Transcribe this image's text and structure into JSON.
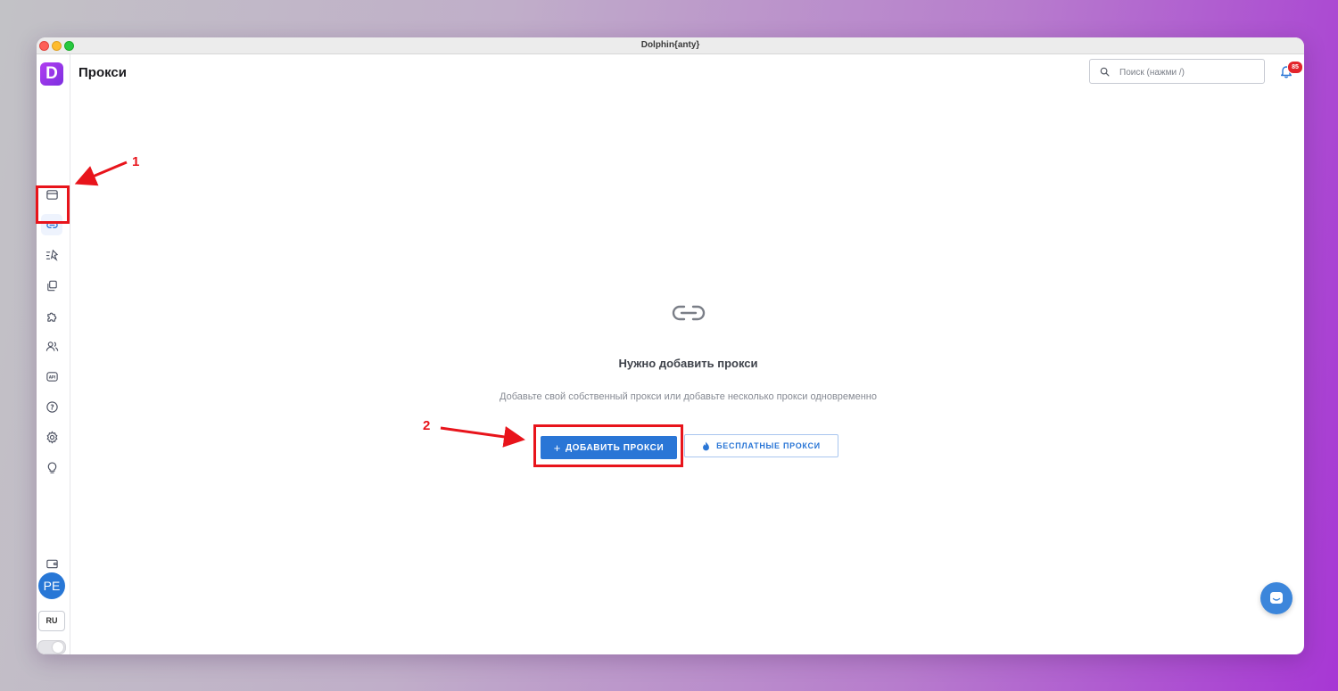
{
  "window": {
    "title": "Dolphin{anty}"
  },
  "logo": {
    "letter": "D"
  },
  "page": {
    "title": "Прокси"
  },
  "search": {
    "placeholder": "Поиск (нажми /)"
  },
  "notifications": {
    "count": "85"
  },
  "empty_state": {
    "title": "Нужно добавить прокси",
    "subtitle": "Добавьте свой собственный прокси или добавьте несколько прокси одновременно",
    "icon": "link-icon"
  },
  "buttons": {
    "add_proxy": "ДОБАВИТЬ ПРОКСИ",
    "add_proxy_icon": "+",
    "free_proxy": "БЕСПЛАТНЫЕ ПРОКСИ"
  },
  "sidebar": {
    "items": [
      {
        "icon": "browser-window-icon",
        "active": false
      },
      {
        "icon": "link-icon",
        "active": true
      },
      {
        "icon": "automation-icon",
        "active": false
      },
      {
        "icon": "copy-icon",
        "active": false
      },
      {
        "icon": "puzzle-icon",
        "active": false
      },
      {
        "icon": "users-icon",
        "active": false
      },
      {
        "icon": "api-icon",
        "active": false
      },
      {
        "icon": "help-icon",
        "active": false
      },
      {
        "icon": "gear-icon",
        "active": false
      },
      {
        "icon": "lightbulb-icon",
        "active": false
      }
    ],
    "wallet_icon": "wallet-icon",
    "user_initials": "PE",
    "language": "RU"
  },
  "annotations": {
    "first": "1",
    "second": "2"
  },
  "colors": {
    "accent": "#2a76d6",
    "annotation": "#e8141b",
    "logo": "#9a36ea",
    "badge": "#e3242b"
  }
}
